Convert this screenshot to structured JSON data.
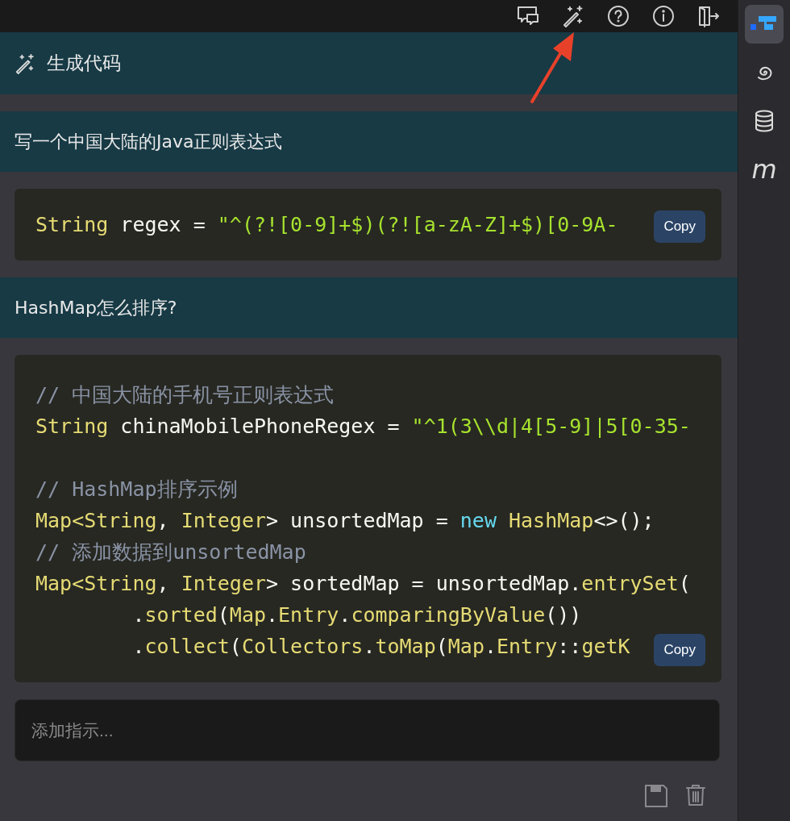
{
  "toolbar": {
    "icons": [
      {
        "kind": "feedback"
      },
      {
        "kind": "wand"
      },
      {
        "kind": "help"
      },
      {
        "kind": "info"
      },
      {
        "kind": "exit"
      }
    ]
  },
  "header": {
    "title": "生成代码"
  },
  "conversation": [
    {
      "kind": "prompt",
      "text": "写一个中国大陆的Java正则表达式"
    },
    {
      "kind": "code",
      "copy": "Copy",
      "lines": [
        [
          {
            "kind": "type",
            "text": "String"
          },
          {
            "kind": "plain",
            "text": " regex = "
          },
          {
            "kind": "string",
            "text": "\"^(?![0-9]+$)(?![a-zA-Z]+$)[0-9A-"
          }
        ]
      ]
    },
    {
      "kind": "prompt",
      "text": "HashMap怎么排序?"
    },
    {
      "kind": "code",
      "copy": "Copy",
      "lines": [
        [
          {
            "kind": "comment",
            "text": "// 中国大陆的手机号正则表达式"
          }
        ],
        [
          {
            "kind": "type",
            "text": "String"
          },
          {
            "kind": "plain",
            "text": " chinaMobilePhoneRegex = "
          },
          {
            "kind": "string",
            "text": "\"^1(3\\\\d|4[5-9]|5[0-35-"
          }
        ],
        {
          "kind": "blank"
        },
        [
          {
            "kind": "comment",
            "text": "// HashMap排序示例"
          }
        ],
        [
          {
            "kind": "type",
            "text": "Map<String"
          },
          {
            "kind": "plain",
            "text": ", "
          },
          {
            "kind": "type",
            "text": "Integer"
          },
          {
            "kind": "plain",
            "text": "> unsortedMap = "
          },
          {
            "kind": "keyword",
            "text": "new"
          },
          {
            "kind": "type",
            "text": " HashMap"
          },
          {
            "kind": "plain",
            "text": "<>();"
          }
        ],
        [
          {
            "kind": "comment",
            "text": "// 添加数据到unsortedMap"
          }
        ],
        [
          {
            "kind": "type",
            "text": "Map<String"
          },
          {
            "kind": "plain",
            "text": ", "
          },
          {
            "kind": "type",
            "text": "Integer"
          },
          {
            "kind": "plain",
            "text": "> sortedMap = unsortedMap."
          },
          {
            "kind": "type",
            "text": "entrySet"
          },
          {
            "kind": "plain",
            "text": "("
          }
        ],
        [
          {
            "kind": "plain",
            "text": "        ."
          },
          {
            "kind": "type",
            "text": "sorted"
          },
          {
            "kind": "plain",
            "text": "("
          },
          {
            "kind": "type",
            "text": "Map"
          },
          {
            "kind": "plain",
            "text": "."
          },
          {
            "kind": "type",
            "text": "Entry"
          },
          {
            "kind": "plain",
            "text": "."
          },
          {
            "kind": "type",
            "text": "comparingByValue"
          },
          {
            "kind": "plain",
            "text": "())"
          }
        ],
        [
          {
            "kind": "plain",
            "text": "        ."
          },
          {
            "kind": "type",
            "text": "collect"
          },
          {
            "kind": "plain",
            "text": "("
          },
          {
            "kind": "type",
            "text": "Collectors"
          },
          {
            "kind": "plain",
            "text": "."
          },
          {
            "kind": "type",
            "text": "toMap"
          },
          {
            "kind": "plain",
            "text": "("
          },
          {
            "kind": "type",
            "text": "Map"
          },
          {
            "kind": "plain",
            "text": "."
          },
          {
            "kind": "type",
            "text": "Entry"
          },
          {
            "kind": "plain",
            "text": "::"
          },
          {
            "kind": "type",
            "text": "getK"
          }
        ]
      ]
    }
  ],
  "instruction": {
    "placeholder": "添加指示..."
  },
  "actions": [
    {
      "kind": "save"
    },
    {
      "kind": "delete"
    }
  ],
  "sidebar": {
    "items": [
      {
        "kind": "logo",
        "selected": true
      },
      {
        "kind": "spiral",
        "selected": false
      },
      {
        "kind": "database",
        "selected": false
      },
      {
        "kind": "letter",
        "label": "m",
        "selected": false
      }
    ]
  },
  "annotation": {
    "kind": "arrow"
  }
}
